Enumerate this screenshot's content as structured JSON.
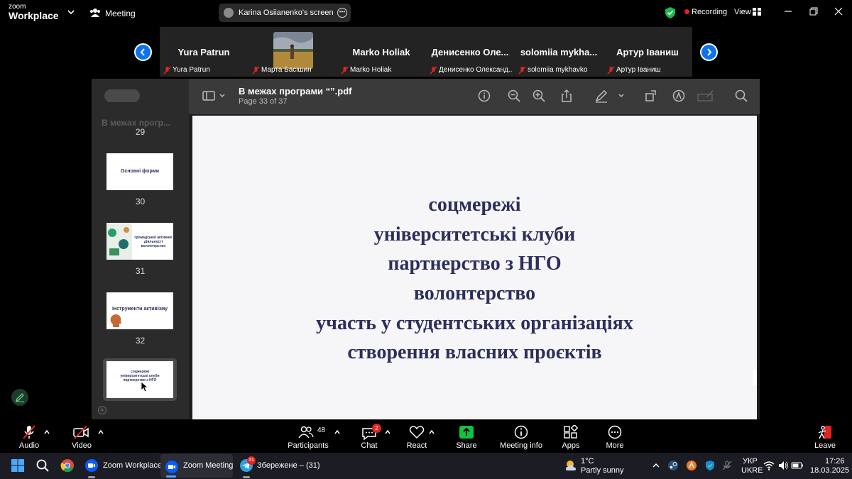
{
  "topbar": {
    "app_name_top": "zoom",
    "app_name_bottom": "Workplace",
    "meeting_label": "Meeting",
    "screen_share_label": "Karina Osiianenko's screen",
    "recording_label": "Recording",
    "view_label": "View"
  },
  "participants": [
    {
      "display": "Yura Patrun",
      "label": "Yura Patrun"
    },
    {
      "display": "",
      "label": "Марта Басішин"
    },
    {
      "display": "Marko Holiak",
      "label": "Marko Holiak"
    },
    {
      "display": "Денисенко  Оле...",
      "label": "Денисенко Олександ..."
    },
    {
      "display": "solomiia  mykha...",
      "label": "solomiia mykhavko"
    },
    {
      "display": "Артур Іваниш",
      "label": "Артур Іваниш"
    }
  ],
  "pdf": {
    "sidebar_title": "В межах прогр...",
    "doc_title": "В межах програми “”.pdf",
    "page_info": "Page 33 of 37",
    "thumbnails": [
      {
        "page": "29",
        "text": ""
      },
      {
        "page": "30",
        "text": "Основні форми"
      },
      {
        "page": "31",
        "text": "громадської активної діяльності волонтерство"
      },
      {
        "page": "32",
        "text": "Інструменти активізму"
      },
      {
        "page": "33",
        "text": "соцмережі університетські клуби партнерство з НГО"
      }
    ],
    "slide_lines": [
      "соцмережі",
      "університетські клуби",
      "партнерство з НГО",
      "волонтерство",
      "участь у студентських організаціях",
      "створення власних проєктів"
    ]
  },
  "bottombar": {
    "audio": "Audio",
    "video": "Video",
    "participants": "Participants",
    "participants_count": "48",
    "chat": "Chat",
    "chat_badge": "2",
    "react": "React",
    "share": "Share",
    "meeting_info": "Meeting info",
    "apps": "Apps",
    "more": "More",
    "leave": "Leave"
  },
  "taskbar": {
    "apps": [
      {
        "label": "Zoom Workplace"
      },
      {
        "label": "Zoom Meeting"
      },
      {
        "label": "Збережене – (31)",
        "badge": "31"
      }
    ],
    "weather_temp": "1°C",
    "weather_desc": "Partly sunny",
    "lang_top": "УКР",
    "lang_bottom": "UKRE",
    "time": "17:26",
    "date": "18.03.2025"
  },
  "colors": {
    "accent": "#0e72ed",
    "recording": "#e02424",
    "share_green": "#12c33e",
    "slide_text": "#2b2f5a"
  }
}
